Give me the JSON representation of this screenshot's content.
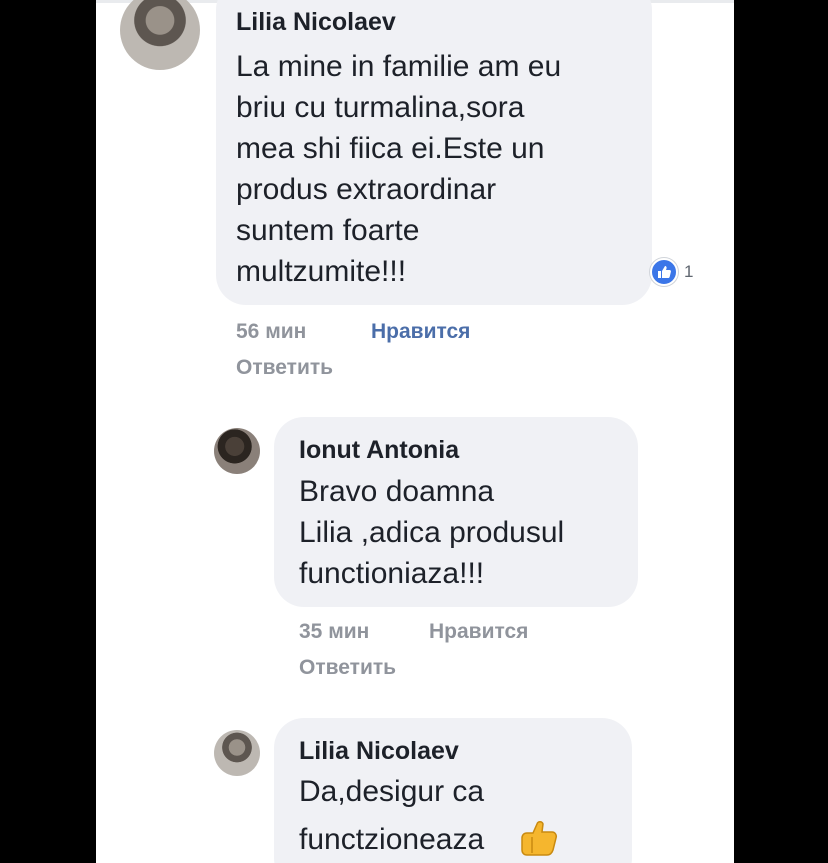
{
  "comments": [
    {
      "author": "Lilia Nicolaev",
      "lines": [
        "La mine in familie  am eu",
        "briu cu turmalina,sora",
        "mea shi fiica ei.Este un",
        "produs extraordinar",
        "suntem foarte",
        "multzumite!!!"
      ],
      "time": "56 мин",
      "like": "Нравится",
      "reply": "Ответить",
      "reaction_count": "1"
    },
    {
      "author": "Ionut Antonia",
      "lines": [
        "Bravo doamna",
        "Lilia ,adica produsul",
        "functioniaza!!!"
      ],
      "time": "35 мин",
      "like": "Нравится",
      "reply": "Ответить"
    },
    {
      "author": "Lilia Nicolaev",
      "lines": [
        "Da,desigur ca",
        "functzioneaza"
      ],
      "emoji": "thumbs-up-emoji"
    }
  ],
  "colors": {
    "bubble": "#f0f1f5",
    "text": "#1d2129",
    "meta": "#90949c",
    "like_active": "#4b6ea9",
    "reaction": "#3b76e8"
  }
}
